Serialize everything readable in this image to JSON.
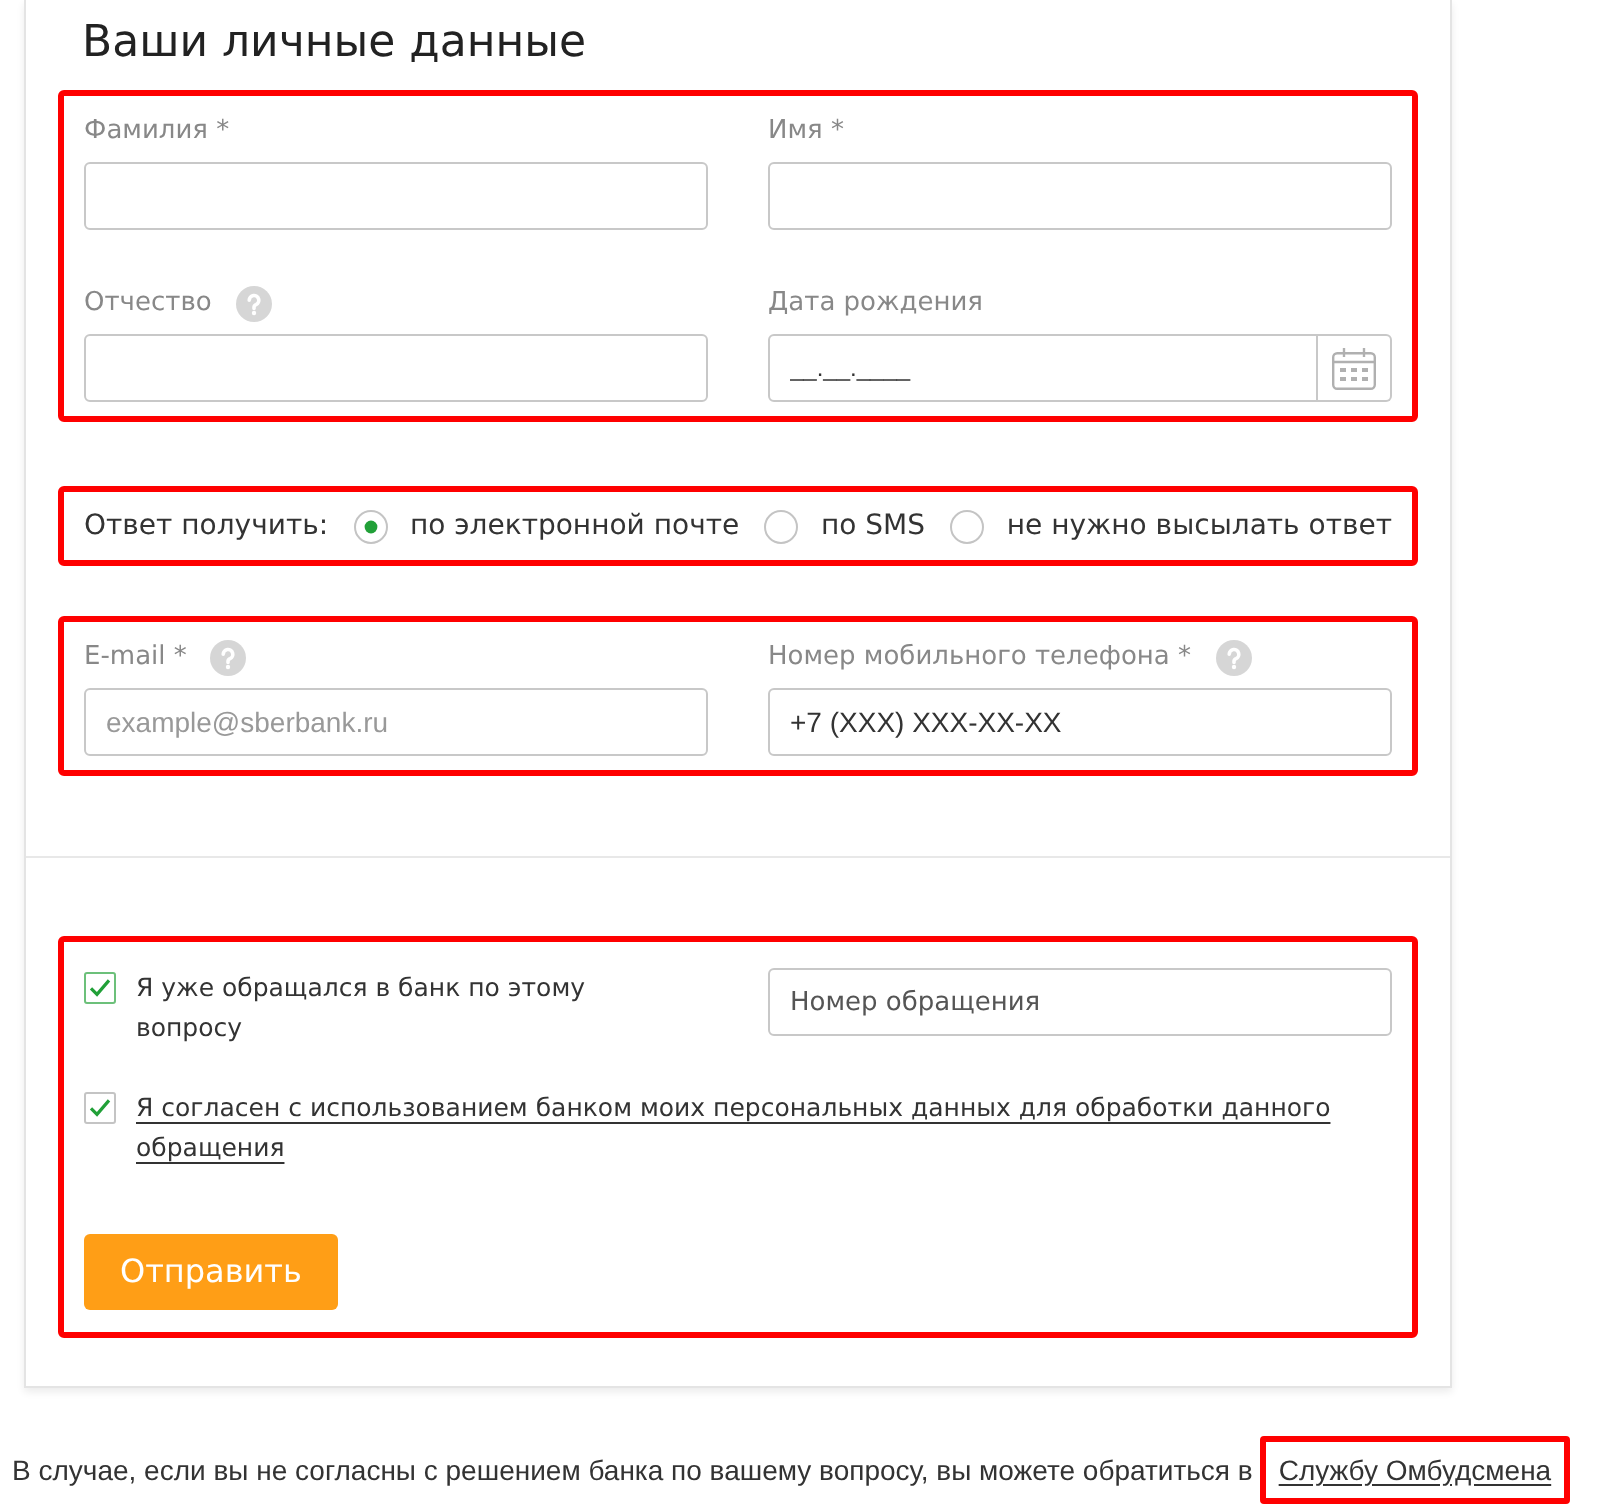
{
  "heading": "Ваши личные данные",
  "sections": [
    {
      "kind": "fields",
      "highlighted": true,
      "fields": [
        {
          "kind": "text",
          "label": "Фамилия *",
          "help": false
        },
        {
          "kind": "text",
          "label": "Имя *",
          "help": false
        },
        {
          "kind": "text",
          "label": "Отчество",
          "help": true
        },
        {
          "kind": "date",
          "label": "Дата рождения",
          "help": false,
          "value": "__.__.____"
        }
      ]
    },
    {
      "kind": "radio",
      "highlighted": true,
      "label": "Ответ получить:",
      "options": [
        {
          "label": "по электронной почте",
          "selected": true
        },
        {
          "label": "по SMS",
          "selected": false
        },
        {
          "label": "не нужно высылать ответ",
          "selected": false
        }
      ]
    },
    {
      "kind": "fields",
      "highlighted": true,
      "fields": [
        {
          "kind": "text",
          "label": "E-mail *",
          "help": true,
          "placeholder": "example@sberbank.ru"
        },
        {
          "kind": "text",
          "label": "Номер мобильного телефона *",
          "help": true,
          "value": "+7 (XXX) XXX-XX-XX"
        }
      ]
    },
    {
      "kind": "agreement",
      "highlighted": true,
      "checkboxes": [
        {
          "kind": "text",
          "label": "Я уже обращался в банк по этому вопросу",
          "checked": true,
          "focused": true
        },
        {
          "kind": "link",
          "label": "Я согласен с использованием банком моих персональных данных для обработки данного обращения",
          "checked": true,
          "focused": false
        }
      ],
      "appeal_field": {
        "placeholder": "Номер обращения"
      },
      "submit": "Отправить"
    }
  ],
  "footer": {
    "text": "В случае, если вы не согласны с решением банка по вашему вопросу, вы можете обратиться в",
    "link": {
      "label": "Службу Омбудсмена",
      "highlighted": true
    }
  }
}
